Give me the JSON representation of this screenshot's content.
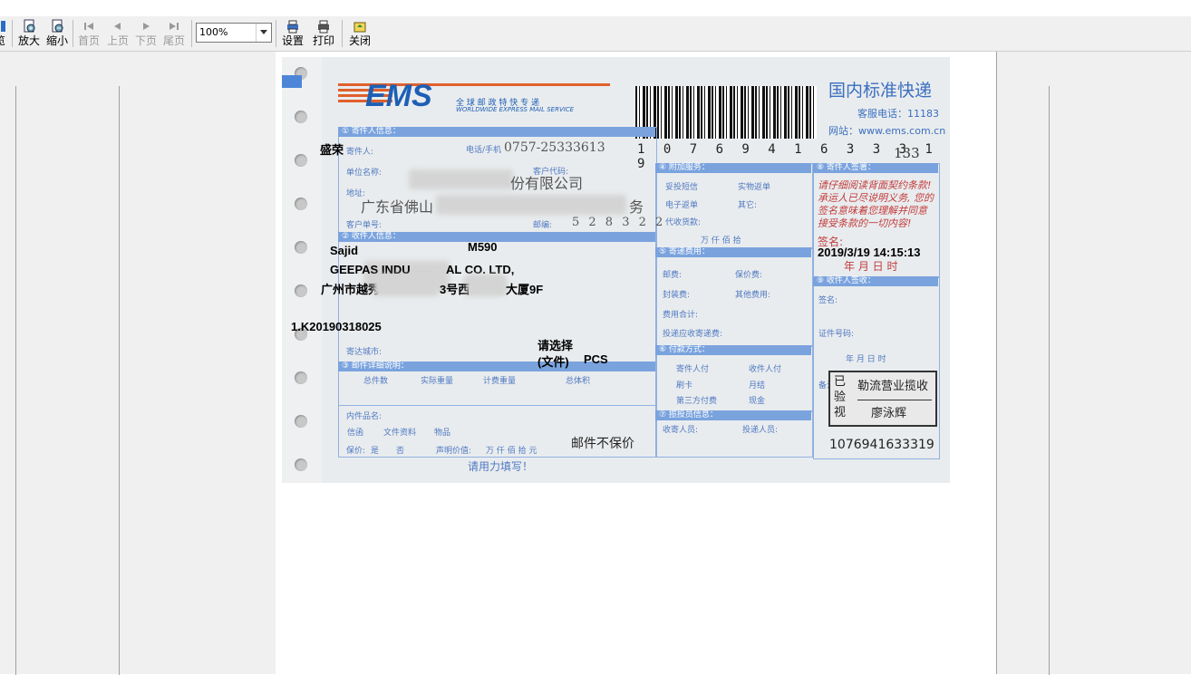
{
  "toolbar": {
    "clipped_label": "览",
    "zoom_in": "放大",
    "zoom_out": "缩小",
    "first_page": "首页",
    "prev_page": "上页",
    "next_page": "下页",
    "last_page": "尾页",
    "zoom_level": "100%",
    "settings": "设置",
    "print": "打印",
    "close": "关闭"
  },
  "form": {
    "logo_text": "EMS",
    "logo_cn": "全 球 邮 政 特 快 专 递",
    "logo_en": "WORLDWIDE EXPRESS MAIL SERVICE",
    "tracking_number": "1 0 7 6 9 4 1 6 3 3 3 1 9",
    "title": "国内标准快递",
    "service_phone": "客服电话：11183",
    "website": "网站：www.ems.com.cn",
    "page_count": "133",
    "sender_section": "① 寄件人信息：",
    "sender_label": "寄件人:",
    "phone_label": "电话/手机",
    "printed_phone": "0757-25333613",
    "company_label": "单位名称:",
    "customer_code_label": "客户代码:",
    "printed_company_tail": "份有限公司",
    "address_label": "地址:",
    "printed_address_head": "广东省佛山",
    "printed_address_tail": "务",
    "order_no_label": "客户单号:",
    "postcode_label": "邮编:",
    "printed_postcode": "5 2 8 3 2 2",
    "recipient_section": "② 收件人信息：",
    "city_label": "寄达城市:",
    "mail_section": "③ 邮件详细说明：",
    "total_pieces": "总件数",
    "actual_weight": "实际重量",
    "charge_weight": "计费重量",
    "total_volume": "总体积",
    "contents_label": "内件品名:",
    "opt_letter": "信函",
    "opt_docs": "文件资料",
    "opt_goods": "物品",
    "insure_label": "保价:",
    "insure_yes": "是",
    "insure_no": "否",
    "declared_label": "声明价值:",
    "declared_units": "万   仟   佰   拾   元",
    "fill_hint": "请用力填写！",
    "extra_section": "④ 附加服务：",
    "sms": "妥投短信",
    "return_phys": "实物返单",
    "return_elec": "电子返单",
    "other": "其它:",
    "cod": "代收货款:",
    "yuan": "元",
    "money_units": "万   仟   佰   拾",
    "fee_section": "⑤ 寄递费用：",
    "postage": "邮费:",
    "insure_fee": "保价费:",
    "packing_fee": "封装费:",
    "other_fee": "其他费用:",
    "total_fee": "费用合计:",
    "cod_fee": "投递应收寄递费:",
    "pay_section": "⑥ 付款方式：",
    "pay_sender": "寄件人付",
    "pay_recipient": "收件人付",
    "pay_card": "刷卡",
    "pay_monthly": "月结",
    "pay_third": "第三方付费",
    "pay_cash": "现金",
    "staff_section": "⑦ 揽投员信息：",
    "collector": "收寄人员:",
    "deliverer": "投递人员:",
    "sign_section": "⑧ 寄件人签署：",
    "sign_terms": "请仔细阅读背面契约条款! 承运人已尽说明义务, 您的签名意味着您理解并同意接受条款的一切内容!",
    "sign_label": "签名:",
    "ymd": "年    月    日    时",
    "recv_section": "⑨ 收件人签收：",
    "recv_sign": "签名:",
    "id_label": "证件号码:",
    "recv_ymd": "年      月      日      时",
    "remark": "备注",
    "stamp_left": "已验视",
    "stamp_top": "勒流营业揽收",
    "stamp_bottom": "廖泳辉",
    "barcode_bottom": "1076941633319"
  },
  "overlay": {
    "sender_name": "盛荣",
    "recipient_name": "Sajid",
    "model": "M590",
    "recipient_company": "GEEPAS INDU",
    "recipient_company_tail": "AL CO. LTD,",
    "recipient_address_head": "广州市越秀",
    "recipient_address_mid": "3号西",
    "recipient_address_tail": "大厦9F",
    "order_number": "1.K20190318025",
    "timestamp": "2019/3/19 14:15:13",
    "select_prompt": "请选择",
    "select_value": "(文件)",
    "unit": "PCS",
    "no_insure": "邮件不保价"
  }
}
